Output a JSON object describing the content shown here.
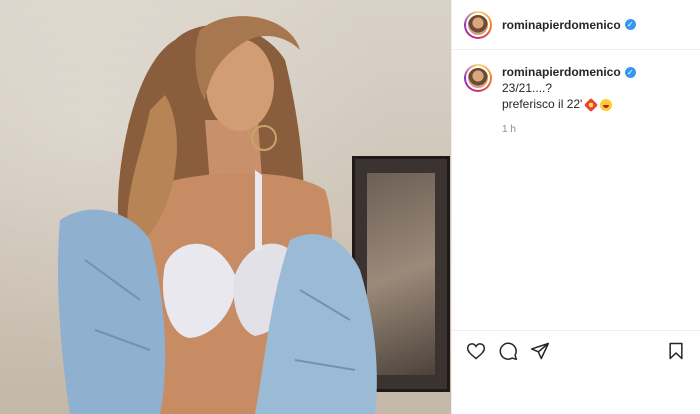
{
  "post": {
    "username": "rominapierdomenico",
    "verified": true
  },
  "caption": {
    "username": "rominapierdomenico",
    "text_line1": "23/21....?",
    "text_line2": "preferisco il 22'",
    "emojis": [
      "collision-emoji",
      "tongue-face-emoji"
    ],
    "time": "1 h"
  },
  "actions": {
    "like": "heart-icon",
    "comment": "comment-icon",
    "share": "paper-plane-icon",
    "save": "bookmark-icon"
  },
  "colors": {
    "verified": "#3897f0",
    "text": "#262626",
    "muted": "#8e8e8e",
    "divider": "#efefef"
  }
}
